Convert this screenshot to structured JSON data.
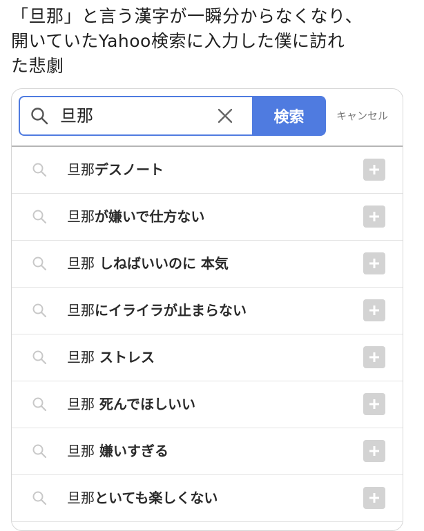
{
  "caption": {
    "line1": "「旦那」と言う漢字が一瞬分からなくなり、",
    "line2": "開いていたYahoo検索に入力した僕に訪れ",
    "line3": "た悲劇"
  },
  "search": {
    "query": "旦那",
    "button_label": "検索",
    "cancel_label": "キャンセル",
    "accent_color": "#4f7be0"
  },
  "icons": {
    "search": "search-icon",
    "clear": "close-icon",
    "add": "plus-icon"
  },
  "suggestions": [
    {
      "keyword": "旦那",
      "rest": "デスノート"
    },
    {
      "keyword": "旦那",
      "rest": "が嫌いで仕方ない"
    },
    {
      "keyword": "旦那",
      "rest": " しねばいいのに 本気"
    },
    {
      "keyword": "旦那",
      "rest": "にイライラが止まらない"
    },
    {
      "keyword": "旦那",
      "rest": " ストレス"
    },
    {
      "keyword": "旦那",
      "rest": " 死んでほしいい"
    },
    {
      "keyword": "旦那",
      "rest": " 嫌いすぎる"
    },
    {
      "keyword": "旦那",
      "rest": "といても楽しくない"
    }
  ]
}
